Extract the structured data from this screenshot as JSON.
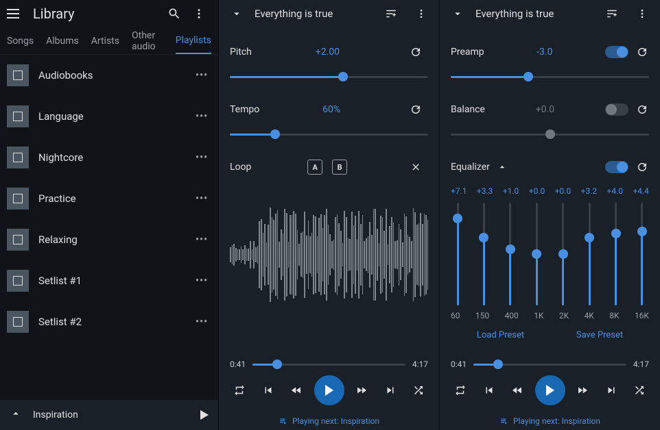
{
  "sidebar": {
    "title": "Library",
    "tabs": [
      "Songs",
      "Albums",
      "Artists",
      "Other audio",
      "Playlists"
    ],
    "active_tab": 4,
    "playlists": [
      "Audiobooks",
      "Language",
      "Nightcore",
      "Practice",
      "Relaxing",
      "Setlist #1",
      "Setlist #2"
    ],
    "now_playing": "Inspiration"
  },
  "pane1": {
    "title": "Everything is true",
    "pitch": {
      "label": "Pitch",
      "value": "+2.00",
      "percent": 57
    },
    "tempo": {
      "label": "Tempo",
      "value": "60%",
      "percent": 23
    },
    "loop": {
      "label": "Loop",
      "a": "A",
      "b": "B"
    },
    "time": {
      "current": "0:41",
      "total": "4:17",
      "percent": 16
    },
    "next": "Playing next: Inspiration"
  },
  "pane2": {
    "title": "Everything is true",
    "preamp": {
      "label": "Preamp",
      "value": "-3.0",
      "on": true,
      "percent": 39
    },
    "balance": {
      "label": "Balance",
      "value": "+0.0",
      "on": false,
      "percent": 50
    },
    "equalizer": {
      "label": "Equalizer",
      "on": true,
      "bands": [
        {
          "freq": "60",
          "val": "+7.1",
          "pct": 85
        },
        {
          "freq": "150",
          "val": "+3.3",
          "pct": 66
        },
        {
          "freq": "400",
          "val": "+1.0",
          "pct": 55
        },
        {
          "freq": "1K",
          "val": "+0.0",
          "pct": 50
        },
        {
          "freq": "2K",
          "val": "+0.0",
          "pct": 50
        },
        {
          "freq": "4K",
          "val": "+3.2",
          "pct": 66
        },
        {
          "freq": "8K",
          "val": "+4.0",
          "pct": 70
        },
        {
          "freq": "16K",
          "val": "+4.4",
          "pct": 72
        }
      ],
      "load": "Load Preset",
      "save": "Save Preset"
    },
    "time": {
      "current": "0:41",
      "total": "4:17",
      "percent": 16
    },
    "next": "Playing next: Inspiration"
  }
}
